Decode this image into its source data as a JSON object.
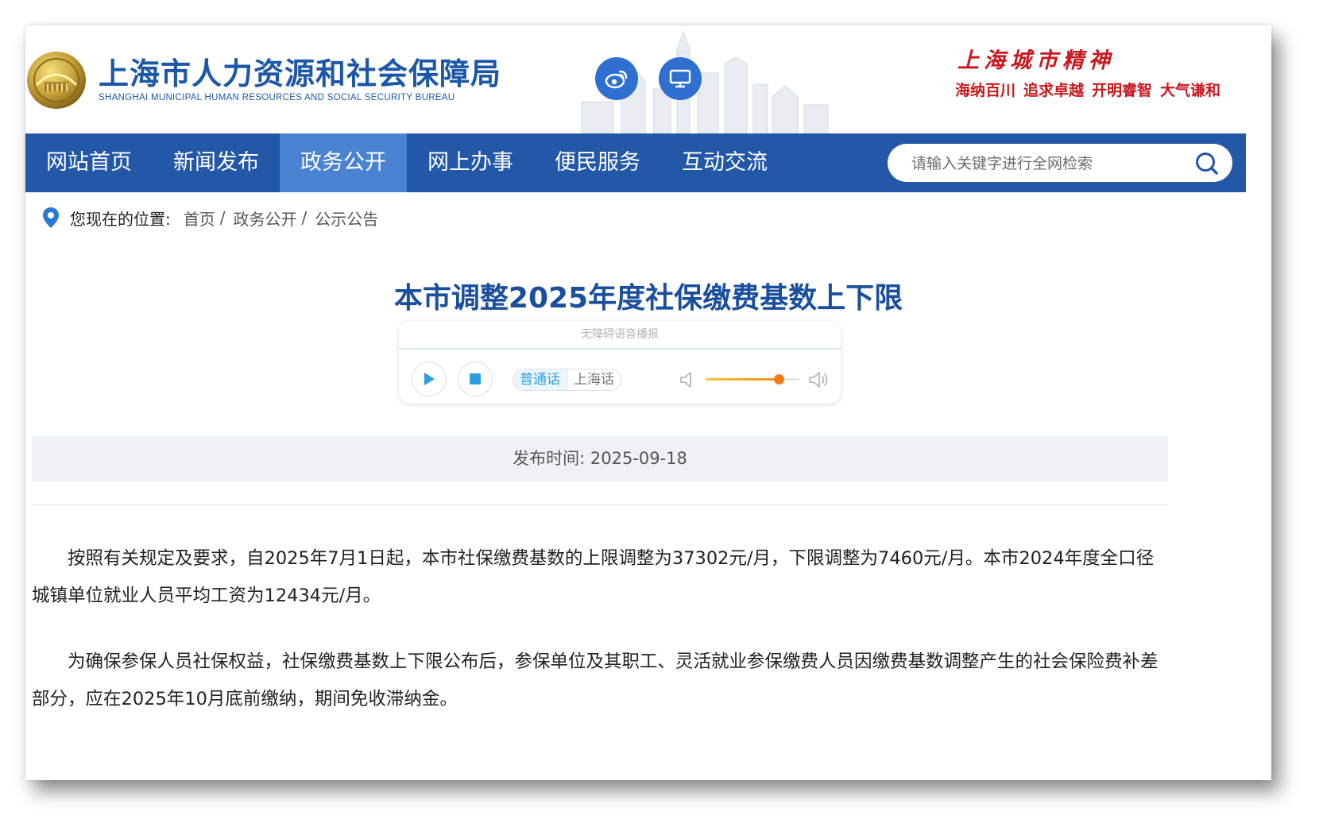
{
  "header": {
    "site_name": "上海市人力资源和社会保障局",
    "site_name_en": "SHANGHAI MUNICIPAL HUMAN RESOURCES AND SOCIAL SECURITY BUREAU",
    "social_icons": [
      "weibo-icon",
      "monitor-icon"
    ],
    "spirit": {
      "title": "上海城市精神",
      "phrases": [
        "海纳百川",
        "追求卓越",
        "开明睿智",
        "大气谦和"
      ]
    }
  },
  "nav": {
    "items": [
      {
        "label": "网站首页",
        "active": false
      },
      {
        "label": "新闻发布",
        "active": false
      },
      {
        "label": "政务公开",
        "active": true
      },
      {
        "label": "网上办事",
        "active": false
      },
      {
        "label": "便民服务",
        "active": false
      },
      {
        "label": "互动交流",
        "active": false
      }
    ],
    "search_placeholder": "请输入关键字进行全网检索"
  },
  "breadcrumb": {
    "label": "您现在的位置:",
    "items": [
      "首页",
      "政务公开",
      "公示公告"
    ],
    "separator": "/"
  },
  "article": {
    "title": "本市调整2025年度社保缴费基数上下限",
    "player": {
      "header": "无障碍语音播报",
      "dialects": [
        "普通话",
        "上海话"
      ],
      "selected_dialect": "普通话",
      "volume": 0.78
    },
    "publish_label": "发布时间:",
    "publish_date": "2025-09-18",
    "paragraphs": [
      "按照有关规定及要求，自2025年7月1日起，本市社保缴费基数的上限调整为37302元/月，下限调整为7460元/月。本市2024年度全口径城镇单位就业人员平均工资为12434元/月。",
      "为确保参保人员社保权益，社保缴费基数上下限公布后，参保单位及其职工、灵活就业参保缴费人员因缴费基数调整产生的社会保险费补差部分，应在2025年10月底前缴纳，期间免收滞纳金。"
    ]
  },
  "colors": {
    "brand_blue": "#2357a7",
    "nav_active": "#4b83d3",
    "title_blue": "#1a4f9e",
    "spirit_red": "#c9181e",
    "player_accent": "#2a9fe0"
  }
}
